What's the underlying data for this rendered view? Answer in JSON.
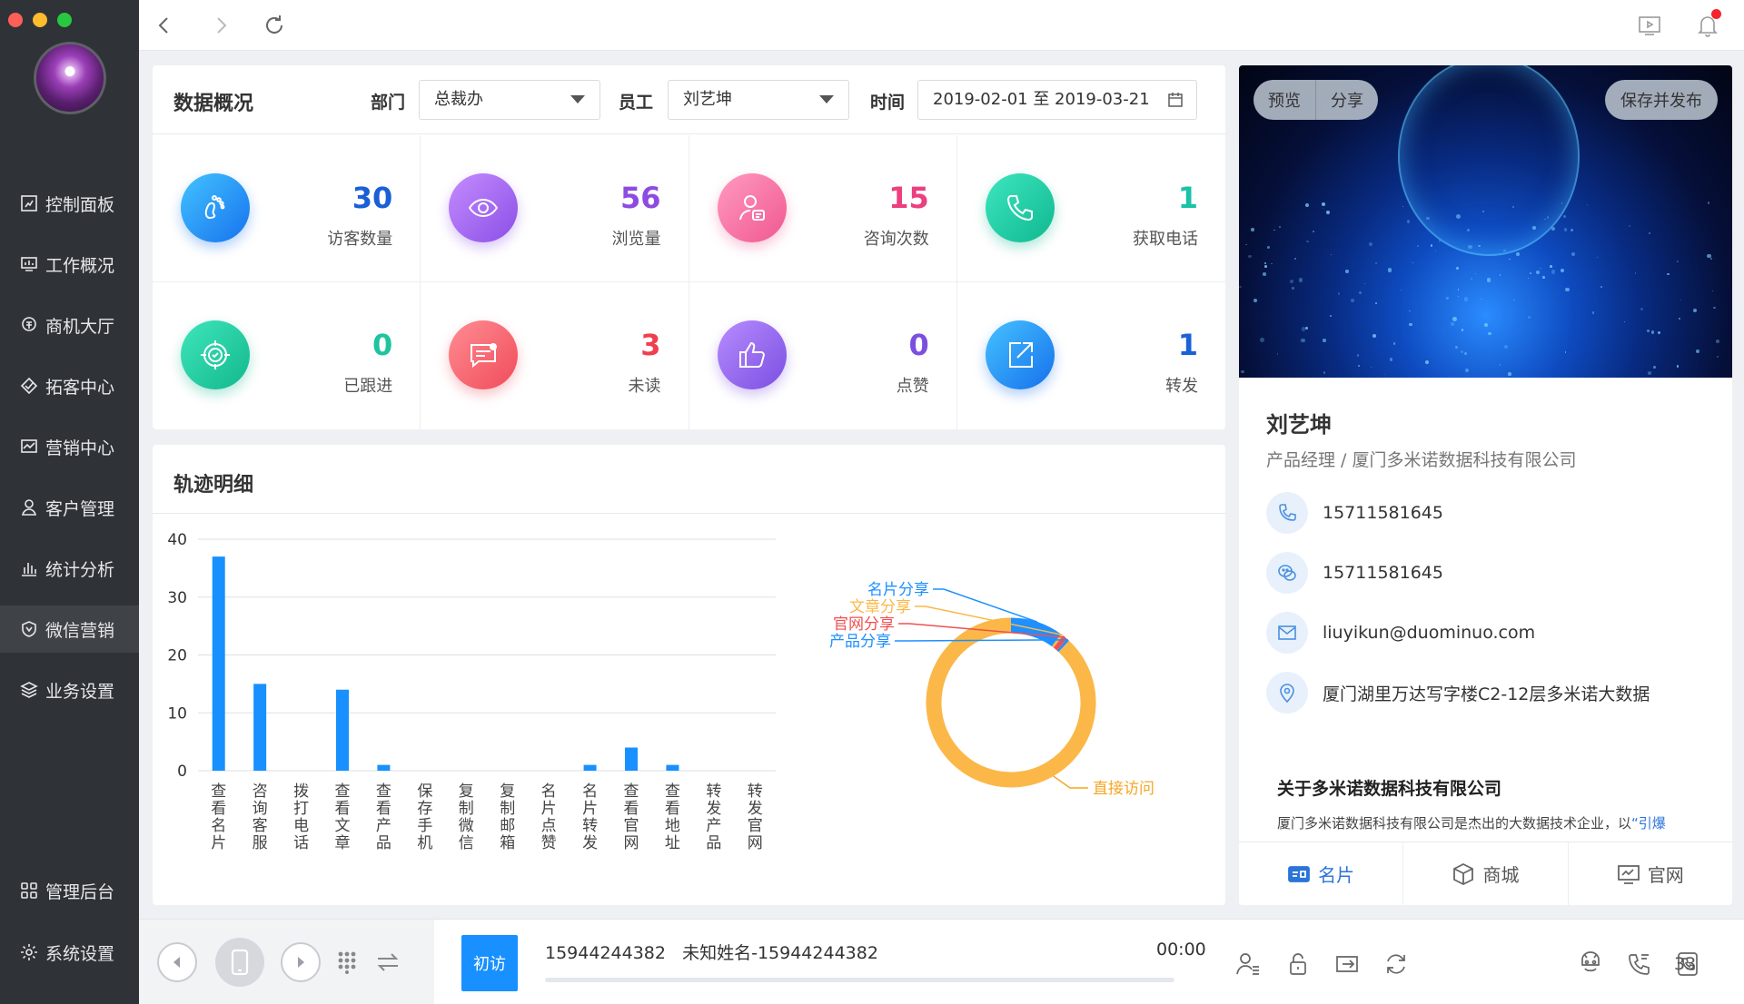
{
  "sidebar": {
    "items": [
      {
        "label": "控制面板",
        "icon": "dashboard-icon"
      },
      {
        "label": "工作概况",
        "icon": "monitor-icon"
      },
      {
        "label": "商机大厅",
        "icon": "opportunity-icon"
      },
      {
        "label": "拓客中心",
        "icon": "diamond-icon"
      },
      {
        "label": "营销中心",
        "icon": "trend-icon"
      },
      {
        "label": "客户管理",
        "icon": "user-icon"
      },
      {
        "label": "统计分析",
        "icon": "bar-chart-icon"
      },
      {
        "label": "微信营销",
        "icon": "shield-icon"
      },
      {
        "label": "业务设置",
        "icon": "layers-icon"
      }
    ],
    "active_index": 7,
    "bottom_items": [
      {
        "label": "管理后台",
        "icon": "grid-icon"
      },
      {
        "label": "系统设置",
        "icon": "gear-icon"
      }
    ]
  },
  "overview": {
    "title": "数据概况",
    "department_label": "部门",
    "department_value": "总裁办",
    "employee_label": "员工",
    "employee_value": "刘艺坤",
    "time_label": "时间",
    "time_value": "2019-02-01 至 2019-03-21",
    "stats": [
      {
        "value": "30",
        "label": "访客数量",
        "color": "#1a5fd6",
        "icon": "footprint-icon",
        "grad": [
          "#43c3ff",
          "#1672ee"
        ]
      },
      {
        "value": "56",
        "label": "浏览量",
        "color": "#8e4be0",
        "icon": "eye-icon",
        "grad": [
          "#c58cff",
          "#8a4fe6"
        ]
      },
      {
        "value": "15",
        "label": "咨询次数",
        "color": "#ec3f7f",
        "icon": "consult-icon",
        "grad": [
          "#ff9ac1",
          "#f0588f"
        ]
      },
      {
        "value": "1",
        "label": "获取电话",
        "color": "#19c2a8",
        "icon": "phone-icon",
        "grad": [
          "#3ee6c1",
          "#10b890"
        ]
      },
      {
        "value": "0",
        "label": "已跟进",
        "color": "#1fc49f",
        "icon": "target-icon",
        "grad": [
          "#40e6bb",
          "#12b88c"
        ]
      },
      {
        "value": "3",
        "label": "未读",
        "color": "#f03f4f",
        "icon": "message-icon",
        "grad": [
          "#ff8d93",
          "#f04b5a"
        ]
      },
      {
        "value": "0",
        "label": "点赞",
        "color": "#7c4fe0",
        "icon": "thumbs-up-icon",
        "grad": [
          "#b78cff",
          "#7b4fe0"
        ]
      },
      {
        "value": "1",
        "label": "转发",
        "color": "#1a62d8",
        "icon": "share-icon",
        "grad": [
          "#45c2ff",
          "#1670ec"
        ]
      }
    ]
  },
  "track": {
    "title": "轨迹明细"
  },
  "chart_data": [
    {
      "type": "bar",
      "categories": [
        "查看名片",
        "咨询客服",
        "拨打电话",
        "查看文章",
        "查看产品",
        "保存手机",
        "复制微信",
        "复制邮箱",
        "名片点赞",
        "名片转发",
        "查看官网",
        "查看地址",
        "转发产品",
        "转发官网"
      ],
      "values": [
        37,
        15,
        0,
        14,
        1,
        0,
        0,
        0,
        0,
        1,
        4,
        1,
        0,
        0
      ],
      "ylim": [
        0,
        40
      ],
      "yticks": [
        0,
        10,
        20,
        30,
        40
      ],
      "color": "#1890ff",
      "grid": true
    },
    {
      "type": "pie",
      "labels": [
        "直接访问",
        "名片分享",
        "文章分享",
        "官网分享",
        "产品分享"
      ],
      "values": [
        0.88,
        0.1,
        0.005,
        0.01,
        0.005
      ],
      "colors": [
        "#fbb848",
        "#1e90ff",
        "#fbb848",
        "#f05050",
        "#1e90ff"
      ],
      "label_colors": [
        "#f5a623",
        "#1e90ff",
        "#fbb848",
        "#f05050",
        "#1e90ff"
      ],
      "donut": true
    }
  ],
  "profile": {
    "preview_label": "预览",
    "share_label": "分享",
    "publish_label": "保存并发布",
    "name": "刘艺坤",
    "title": "产品经理 / 厦门多米诺数据科技有限公司",
    "phone": "15711581645",
    "wechat": "15711581645",
    "email": "liuyikun@duominuo.com",
    "address": "厦门湖里万达写字楼C2-12层多米诺大数据",
    "about_title": "关于多米诺数据科技有限公司",
    "about_text": "厦门多米诺数据科技有限公司是杰出的大数据技术企业，以",
    "about_highlight": "“引爆",
    "tabs": [
      {
        "label": "名片",
        "icon": "card-icon"
      },
      {
        "label": "商城",
        "icon": "box-icon"
      },
      {
        "label": "官网",
        "icon": "website-icon"
      }
    ]
  },
  "callbar": {
    "visit_label": "初访",
    "caller": "15944244382   未知姓名-15944244382",
    "timer": "00:00",
    "progress": 0,
    "call_count": "33"
  }
}
